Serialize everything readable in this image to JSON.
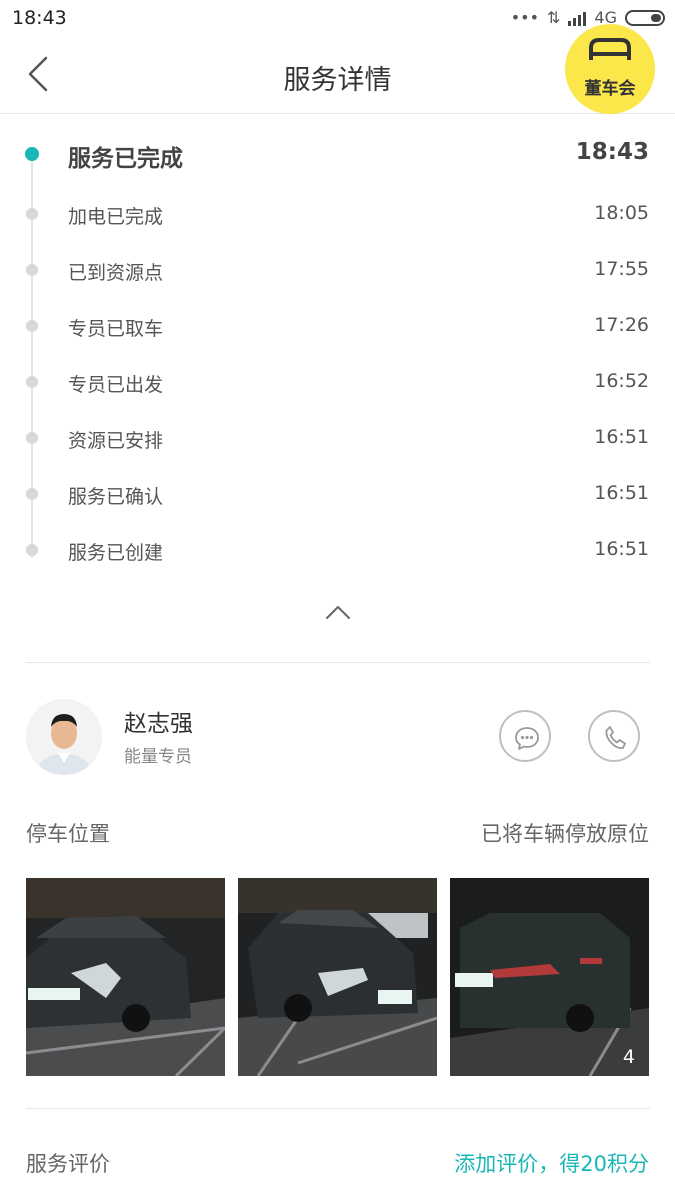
{
  "status_bar": {
    "time": "18:43",
    "network": "4G"
  },
  "header": {
    "title": "服务详情",
    "club_label": "董车会"
  },
  "timeline": [
    {
      "label": "服务已完成",
      "time": "18:43",
      "active": true
    },
    {
      "label": "加电已完成",
      "time": "18:05"
    },
    {
      "label": "已到资源点",
      "time": "17:55"
    },
    {
      "label": "专员已取车",
      "time": "17:26"
    },
    {
      "label": "专员已出发",
      "time": "16:52"
    },
    {
      "label": "资源已安排",
      "time": "16:51"
    },
    {
      "label": "服务已确认",
      "time": "16:51"
    },
    {
      "label": "服务已创建",
      "time": "16:51"
    }
  ],
  "specialist": {
    "name": "赵志强",
    "role": "能量专员"
  },
  "parking": {
    "title": "停车位置",
    "status": "已将车辆停放原位",
    "photo_count": "4"
  },
  "rating": {
    "title": "服务评价",
    "link": "添加评价，得20积分"
  },
  "colors": {
    "accent": "#1ab7b7",
    "badge": "#fbe74a"
  }
}
